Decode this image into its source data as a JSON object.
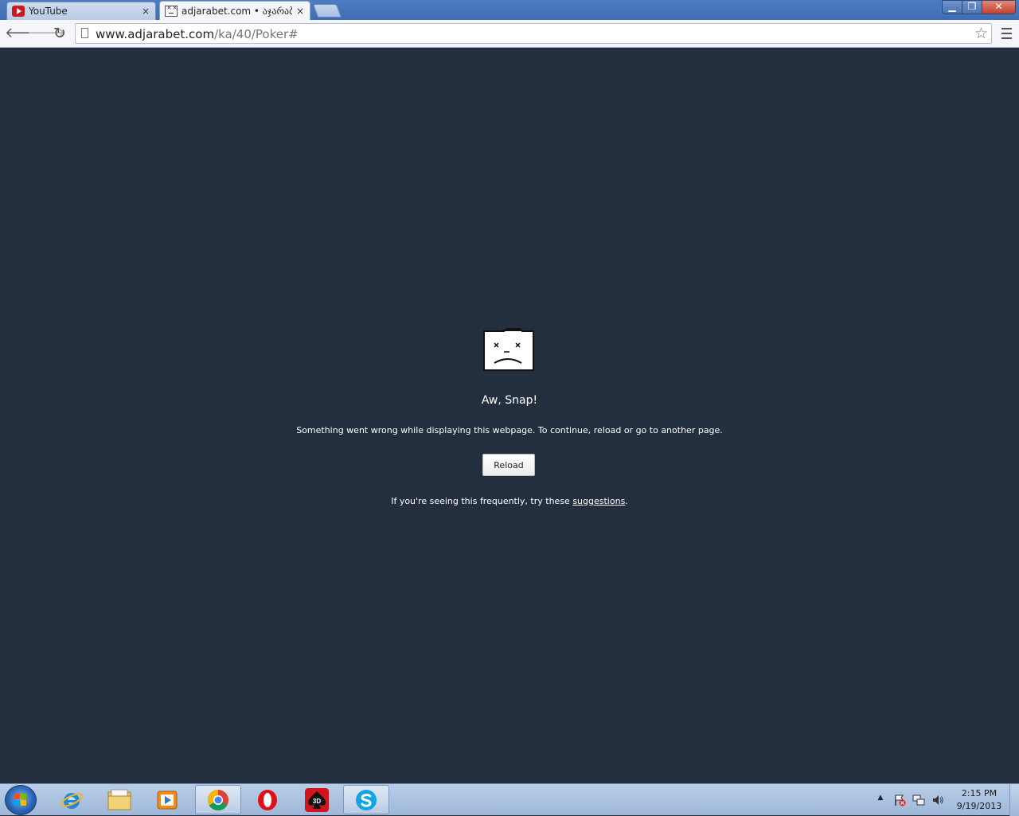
{
  "window": {
    "tabs": [
      {
        "title": "YouTube",
        "close": "×"
      },
      {
        "title": "adjarabet.com • აჯარაბეთ",
        "close": "×"
      }
    ],
    "controls": {
      "minimize": "▁",
      "maximize": "❐",
      "close": "✕"
    }
  },
  "toolbar": {
    "back": "🡐",
    "forward": "🡒",
    "reload": "↻",
    "url_host": "www.adjarabet.com",
    "url_path": "/ka/40/Poker#",
    "star": "☆"
  },
  "error": {
    "heading": "Aw, Snap!",
    "message": "Something went wrong while displaying this webpage. To continue, reload or go to another page.",
    "reload_label": "Reload",
    "suggest_prefix": "If you're seeing this frequently, try these ",
    "suggest_link": "suggestions",
    "suggest_suffix": "."
  },
  "taskbar": {
    "pinned": [
      "start-button",
      "internet-explorer-icon",
      "file-explorer-icon",
      "media-player-icon",
      "chrome-icon",
      "opera-icon",
      "poker-3d-icon",
      "skype-icon"
    ],
    "poker_label": "3D",
    "tray_arrow": "▲",
    "time": "2:15 PM",
    "date": "9/19/2013"
  },
  "colors": {
    "content_bg": "#232f3f",
    "titlebar": "#3e6db3",
    "taskbar": "#a9c0de"
  }
}
